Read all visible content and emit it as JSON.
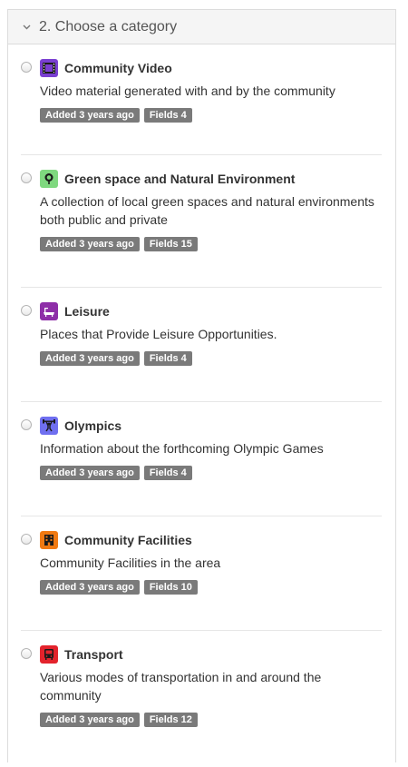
{
  "panel": {
    "title": "2. Choose a category"
  },
  "categories": [
    {
      "title": "Community Video",
      "description": "Video material generated with and by the community",
      "added": "Added 3 years ago",
      "fields": "Fields 4",
      "icon": "film-icon",
      "color": "#7a3fd1"
    },
    {
      "title": "Green space and Natural Environment",
      "description": "A collection of local green spaces and natural environments both public and private",
      "added": "Added 3 years ago",
      "fields": "Fields 15",
      "icon": "tree-icon",
      "color": "#7fd87f"
    },
    {
      "title": "Leisure",
      "description": "Places that Provide Leisure Opportunities.",
      "added": "Added 3 years ago",
      "fields": "Fields 4",
      "icon": "bathtub-icon",
      "color": "#8e2ea8"
    },
    {
      "title": "Olympics",
      "description": "Information about the forthcoming Olympic Games",
      "added": "Added 3 years ago",
      "fields": "Fields 4",
      "icon": "weightlifting-icon",
      "color": "#6f6ff0"
    },
    {
      "title": "Community Facilities",
      "description": "Community Facilities in the area",
      "added": "Added 3 years ago",
      "fields": "Fields 10",
      "icon": "building-icon",
      "color": "#f07a12"
    },
    {
      "title": "Transport",
      "description": "Various modes of transportation in and around the community",
      "added": "Added 3 years ago",
      "fields": "Fields 12",
      "icon": "bus-icon",
      "color": "#e3232c"
    }
  ]
}
